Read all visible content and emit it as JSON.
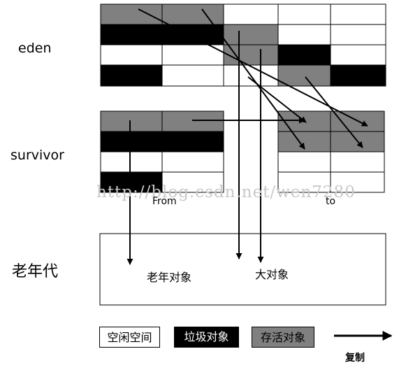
{
  "labels": {
    "eden": "eden",
    "survivor": "survivor",
    "old_gen": "老年代",
    "from": "From",
    "to": "to",
    "old_object": "老年对象",
    "large_object": "大对象"
  },
  "legend": {
    "free": "空闲空间",
    "garbage": "垃圾对象",
    "alive": "存活对象",
    "copy": "复制"
  },
  "watermark": "http://blog.csdn.net/wen7280",
  "colors": {
    "free": "#ffffff",
    "garbage": "#000000",
    "alive": "#808080",
    "border": "#000000"
  },
  "grids": {
    "eden": [
      [
        "alive",
        "alive",
        "free",
        "free",
        "free"
      ],
      [
        "garbage",
        "garbage",
        "alive",
        "free",
        "free"
      ],
      [
        "free",
        "free",
        "alive",
        "garbage",
        "free"
      ],
      [
        "garbage",
        "free",
        "free",
        "alive",
        "garbage"
      ]
    ],
    "from": [
      [
        "alive",
        "alive"
      ],
      [
        "garbage",
        "garbage"
      ],
      [
        "free",
        "free"
      ],
      [
        "garbage",
        "free"
      ]
    ],
    "to": [
      [
        "alive",
        "alive"
      ],
      [
        "alive",
        "alive"
      ],
      [
        "free",
        "free"
      ],
      [
        "free",
        "free"
      ]
    ]
  }
}
